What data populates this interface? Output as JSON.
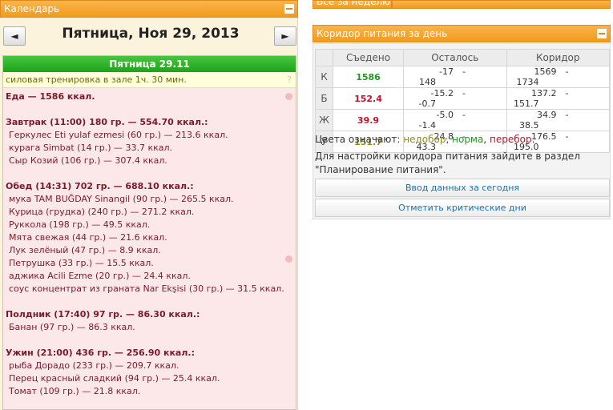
{
  "calendar": {
    "panel_title": "Календарь",
    "prev_label": "◄",
    "next_label": "►",
    "date_title": "Пятница, Ноя 29, 2013",
    "day_header": "Пятница 29.11",
    "workout": "силовая тренировка в зале 1ч. 30 мин.",
    "workout_hint": "?",
    "food_total": "Еда — 1586 ккал.",
    "meals": [
      {
        "title": "Завтрак (11:00) 180 гр. — 554.70 ккал.:",
        "items": [
          "Геркулес Eti yulaf ezmesi (60 гр.) — 213.6 ккал.",
          "курага Simbat (14 гр.) — 33.7 ккал.",
          "Сыр Козий (106 гр.) — 307.4 ккал."
        ]
      },
      {
        "title": "Обед (14:31) 702 гр. — 688.10 ккал.:",
        "items": [
          "мука TAM BUĞDAY Sinangil (90 гр.) — 265.5 ккал.",
          "Курица (грудка) (240 гр.) — 271.2 ккал.",
          "Руккола (198 гр.) — 49.5 ккал.",
          "Мята свежая (44 гр.) — 21.6 ккал.",
          "Лук зелёный (47 гр.) — 8.9 ккал.",
          "Петрушка (33 гр.) — 15.5 ккал.",
          "аджика Acili Ezme (20 гр.) — 24.4 ккал.",
          "соус концентрат из граната Nar Ekşisi (30 гр.) — 31.5 ккал."
        ]
      },
      {
        "title": "Полдник (17:40) 97 гр. — 86.30 ккал.:",
        "items": [
          "Банан (97 гр.) — 86.3 ккал."
        ]
      },
      {
        "title": "Ужин (21:00) 436 гр. — 256.90 ккал.:",
        "items": [
          "рыба Дорадо (233 гр.) — 209.7 ккал.",
          "Перец красный сладкий (94 гр.) — 25.4 ккал.",
          "Томат (109 гр.) — 21.8 ккал."
        ]
      }
    ]
  },
  "week_panel": {
    "title": "Все за неделю"
  },
  "corridor": {
    "panel_title": "Коридор питания за день",
    "headers": {
      "eaten": "Съедено",
      "left": "Осталось",
      "corridor": "Коридор"
    },
    "rows": [
      {
        "label": "К",
        "eaten": "1586",
        "status": "g",
        "left_min": "-17",
        "left_max": "148",
        "corr_min": "1569",
        "corr_max": "1734"
      },
      {
        "label": "Б",
        "eaten": "152.4",
        "status": "r",
        "left_min": "-15.2",
        "left_max": "-0.7",
        "corr_min": "137.2",
        "corr_max": "151.7"
      },
      {
        "label": "Ж",
        "eaten": "39.9",
        "status": "r",
        "left_min": "-5.0",
        "left_max": "-1.4",
        "corr_min": "34.9",
        "corr_max": "38.5"
      },
      {
        "label": "У",
        "eaten": "151.7",
        "status": "o",
        "left_min": "24.8",
        "left_max": "43.3",
        "corr_min": "176.5",
        "corr_max": "195.0"
      }
    ],
    "dash": "-",
    "legend_prefix": "Цвета означают: ",
    "legend_under": "недобор",
    "legend_norm": "норма",
    "legend_over": "перебор",
    "sep": ", ",
    "dot": ".",
    "info": "Для настройки коридора питания зайдите в раздел \"Планирование питания\".",
    "btn_today": "Ввод данных за сегодня",
    "btn_critical": "Отметить критические дни"
  },
  "colors": {
    "under": "#8e8c12",
    "norm": "#1d9a1d",
    "over": "#c0142d",
    "accent": "#f29a1f"
  }
}
